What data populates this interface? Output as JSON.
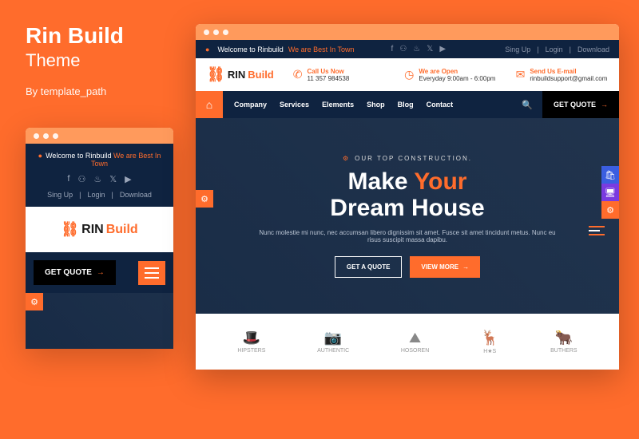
{
  "title": {
    "name": "Rin Build",
    "sub": "Theme",
    "by": "By template_path"
  },
  "topbar": {
    "welcome_pre": "Welcome to Rinbuild",
    "welcome_tag": "We are Best In Town",
    "links": {
      "signup": "Sing Up",
      "login": "Login",
      "download": "Download"
    }
  },
  "info": {
    "call": {
      "label": "Call Us Now",
      "val": "11 357 984538"
    },
    "open": {
      "label": "We are Open",
      "val": "Everyday 9:00am - 6:00pm"
    },
    "mail": {
      "label": "Send Us E-mail",
      "val": "rinbuildsupport@gmail.com"
    }
  },
  "logo": {
    "part1": "RIN",
    "part2": "Build"
  },
  "nav": {
    "company": "Company",
    "services": "Services",
    "elements": "Elements",
    "shop": "Shop",
    "blog": "Blog",
    "contact": "Contact"
  },
  "quote": "GET QUOTE",
  "hero": {
    "eyebrow": "OUR TOP CONSTRUCTION.",
    "h_pre": "Make ",
    "h_accent": "Your",
    "h_post": "Dream House",
    "desc": "Nunc molestie mi nunc, nec accumsan libero dignissim sit amet. Fusce sit amet tincidunt metus. Nunc eu risus suscipit massa dapibu.",
    "btn1": "GET A QUOTE",
    "btn2": "VIEW MORE"
  },
  "clients": {
    "c1": "HIPSTERS",
    "c2": "AUTHENTIC",
    "c3": "HOSOREN",
    "c4": "H★S",
    "c5": "BUTHERS"
  }
}
